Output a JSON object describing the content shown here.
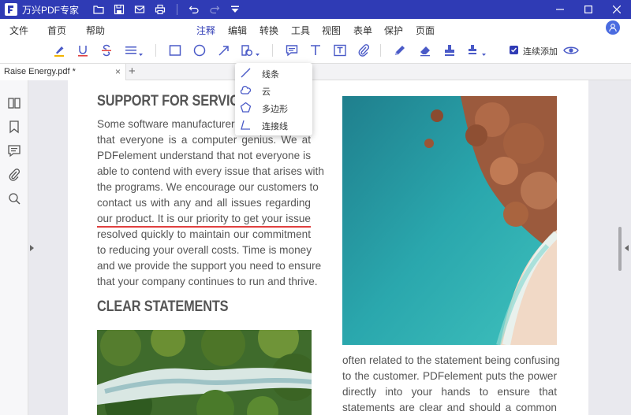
{
  "app": {
    "title": "万兴PDF专家"
  },
  "menu": {
    "items": [
      "文件",
      "首页",
      "帮助",
      "注释",
      "编辑",
      "转换",
      "工具",
      "视图",
      "表单",
      "保护",
      "页面"
    ],
    "active": "注释"
  },
  "toolbar": {
    "continuous_add_label": "连续添加",
    "continuous_add_checked": true
  },
  "tabs": {
    "document": "Raise Energy.pdf *",
    "close": "×",
    "new": "+"
  },
  "shape_menu": {
    "items": [
      {
        "label": "线条",
        "icon": "line-icon"
      },
      {
        "label": "云",
        "icon": "cloud-icon"
      },
      {
        "label": "多边形",
        "icon": "polygon-icon"
      },
      {
        "label": "连接线",
        "icon": "connected-line-icon"
      }
    ]
  },
  "document": {
    "heading1": "SUPPORT FOR SERVICE",
    "para1": [
      "Some software manufacturers",
      "that everyone is a computer genius. We at",
      "PDFelement understand that not everyone is",
      "able to contend with every issue that arises with",
      "the programs. We encourage our customers to",
      "contact us with any and all issues regarding",
      "our product. It is our priority to get your issue",
      "resolved quickly to maintain our commitment",
      "to reducing your overall costs. Time is money",
      "and we provide the support you need to ensure",
      "that your company continues to run and thrive."
    ],
    "heading2": "CLEAR STATEMENTS",
    "para2": [
      "often related to the statement being confusing",
      "to the customer. PDFelement puts the power",
      "directly into your hands to ensure that",
      "statements are clear and should a common"
    ]
  },
  "colors": {
    "brand": "#2f3bb5",
    "annotation_underline": "#e0403f"
  }
}
